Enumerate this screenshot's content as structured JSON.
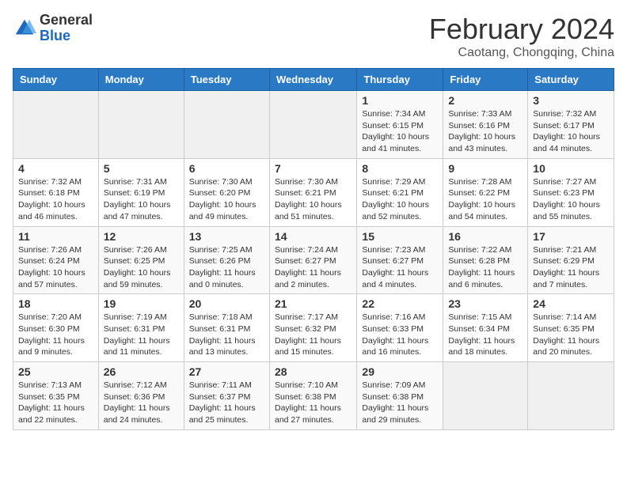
{
  "logo": {
    "general": "General",
    "blue": "Blue"
  },
  "title": "February 2024",
  "subtitle": "Caotang, Chongqing, China",
  "days_of_week": [
    "Sunday",
    "Monday",
    "Tuesday",
    "Wednesday",
    "Thursday",
    "Friday",
    "Saturday"
  ],
  "weeks": [
    [
      {
        "day": "",
        "info": ""
      },
      {
        "day": "",
        "info": ""
      },
      {
        "day": "",
        "info": ""
      },
      {
        "day": "",
        "info": ""
      },
      {
        "day": "1",
        "info": "Sunrise: 7:34 AM\nSunset: 6:15 PM\nDaylight: 10 hours and 41 minutes."
      },
      {
        "day": "2",
        "info": "Sunrise: 7:33 AM\nSunset: 6:16 PM\nDaylight: 10 hours and 43 minutes."
      },
      {
        "day": "3",
        "info": "Sunrise: 7:32 AM\nSunset: 6:17 PM\nDaylight: 10 hours and 44 minutes."
      }
    ],
    [
      {
        "day": "4",
        "info": "Sunrise: 7:32 AM\nSunset: 6:18 PM\nDaylight: 10 hours and 46 minutes."
      },
      {
        "day": "5",
        "info": "Sunrise: 7:31 AM\nSunset: 6:19 PM\nDaylight: 10 hours and 47 minutes."
      },
      {
        "day": "6",
        "info": "Sunrise: 7:30 AM\nSunset: 6:20 PM\nDaylight: 10 hours and 49 minutes."
      },
      {
        "day": "7",
        "info": "Sunrise: 7:30 AM\nSunset: 6:21 PM\nDaylight: 10 hours and 51 minutes."
      },
      {
        "day": "8",
        "info": "Sunrise: 7:29 AM\nSunset: 6:21 PM\nDaylight: 10 hours and 52 minutes."
      },
      {
        "day": "9",
        "info": "Sunrise: 7:28 AM\nSunset: 6:22 PM\nDaylight: 10 hours and 54 minutes."
      },
      {
        "day": "10",
        "info": "Sunrise: 7:27 AM\nSunset: 6:23 PM\nDaylight: 10 hours and 55 minutes."
      }
    ],
    [
      {
        "day": "11",
        "info": "Sunrise: 7:26 AM\nSunset: 6:24 PM\nDaylight: 10 hours and 57 minutes."
      },
      {
        "day": "12",
        "info": "Sunrise: 7:26 AM\nSunset: 6:25 PM\nDaylight: 10 hours and 59 minutes."
      },
      {
        "day": "13",
        "info": "Sunrise: 7:25 AM\nSunset: 6:26 PM\nDaylight: 11 hours and 0 minutes."
      },
      {
        "day": "14",
        "info": "Sunrise: 7:24 AM\nSunset: 6:27 PM\nDaylight: 11 hours and 2 minutes."
      },
      {
        "day": "15",
        "info": "Sunrise: 7:23 AM\nSunset: 6:27 PM\nDaylight: 11 hours and 4 minutes."
      },
      {
        "day": "16",
        "info": "Sunrise: 7:22 AM\nSunset: 6:28 PM\nDaylight: 11 hours and 6 minutes."
      },
      {
        "day": "17",
        "info": "Sunrise: 7:21 AM\nSunset: 6:29 PM\nDaylight: 11 hours and 7 minutes."
      }
    ],
    [
      {
        "day": "18",
        "info": "Sunrise: 7:20 AM\nSunset: 6:30 PM\nDaylight: 11 hours and 9 minutes."
      },
      {
        "day": "19",
        "info": "Sunrise: 7:19 AM\nSunset: 6:31 PM\nDaylight: 11 hours and 11 minutes."
      },
      {
        "day": "20",
        "info": "Sunrise: 7:18 AM\nSunset: 6:31 PM\nDaylight: 11 hours and 13 minutes."
      },
      {
        "day": "21",
        "info": "Sunrise: 7:17 AM\nSunset: 6:32 PM\nDaylight: 11 hours and 15 minutes."
      },
      {
        "day": "22",
        "info": "Sunrise: 7:16 AM\nSunset: 6:33 PM\nDaylight: 11 hours and 16 minutes."
      },
      {
        "day": "23",
        "info": "Sunrise: 7:15 AM\nSunset: 6:34 PM\nDaylight: 11 hours and 18 minutes."
      },
      {
        "day": "24",
        "info": "Sunrise: 7:14 AM\nSunset: 6:35 PM\nDaylight: 11 hours and 20 minutes."
      }
    ],
    [
      {
        "day": "25",
        "info": "Sunrise: 7:13 AM\nSunset: 6:35 PM\nDaylight: 11 hours and 22 minutes."
      },
      {
        "day": "26",
        "info": "Sunrise: 7:12 AM\nSunset: 6:36 PM\nDaylight: 11 hours and 24 minutes."
      },
      {
        "day": "27",
        "info": "Sunrise: 7:11 AM\nSunset: 6:37 PM\nDaylight: 11 hours and 25 minutes."
      },
      {
        "day": "28",
        "info": "Sunrise: 7:10 AM\nSunset: 6:38 PM\nDaylight: 11 hours and 27 minutes."
      },
      {
        "day": "29",
        "info": "Sunrise: 7:09 AM\nSunset: 6:38 PM\nDaylight: 11 hours and 29 minutes."
      },
      {
        "day": "",
        "info": ""
      },
      {
        "day": "",
        "info": ""
      }
    ]
  ]
}
